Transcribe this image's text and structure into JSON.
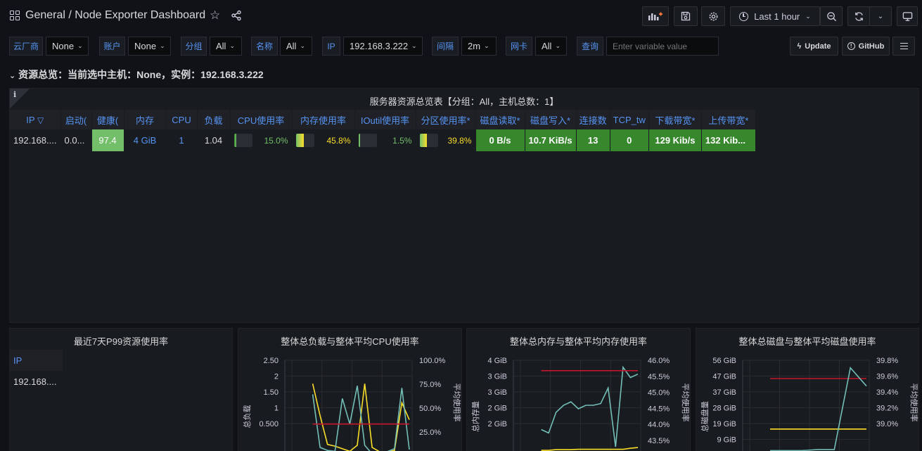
{
  "header": {
    "breadcrumb": "General / Node Exporter Dashboard",
    "time_range": "Last 1 hour",
    "icons": [
      "apps-icon",
      "star-icon",
      "share-icon",
      "add-panel-icon",
      "save-icon",
      "gear-icon",
      "clock-icon",
      "chevron-down-icon",
      "zoom-out-icon",
      "refresh-icon",
      "chevron-down-icon",
      "tv-monitor-icon"
    ]
  },
  "variables": [
    {
      "label": "云厂商",
      "value": "None"
    },
    {
      "label": "账户",
      "value": "None"
    },
    {
      "label": "分组",
      "value": "All"
    },
    {
      "label": "名称",
      "value": "All"
    },
    {
      "label": "IP",
      "value": "192.168.3.222"
    },
    {
      "label": "间隔",
      "value": "2m"
    },
    {
      "label": "网卡",
      "value": "All"
    },
    {
      "label": "查询",
      "placeholder": "Enter variable value"
    }
  ],
  "links": {
    "update": "Update",
    "github": "GitHub"
  },
  "row": {
    "title": "资源总览：当前选中主机：None，实例：192.168.3.222"
  },
  "overview_panel": {
    "info_glyph": "i",
    "title": "服务器资源总览表【分组：All，主机总数：1】",
    "columns": [
      "IP",
      "启动(",
      "健康(",
      "内存",
      "CPU",
      "负载",
      "CPU使用率",
      "内存使用率",
      "IOutil使用率",
      "分区使用率*",
      "磁盘读取*",
      "磁盘写入*",
      "连接数",
      "TCP_tw",
      "下载带宽*",
      "上传带宽*"
    ],
    "row": {
      "ip": "192.168....",
      "uptime": "0.0...",
      "health": "97.4",
      "memory": "4 GiB",
      "cpu": "1",
      "load": "1.04",
      "cpu_usage": "15.0%",
      "cpu_usage_level": 0.15,
      "mem_usage": "45.8%",
      "mem_usage_level": 0.458,
      "ioutil": "1.5%",
      "ioutil_level": 0.015,
      "partition": "39.8%",
      "partition_level": 0.398,
      "disk_read": "0 B/s",
      "disk_write": "10.7 KiB/s",
      "connections": "13",
      "tcp_tw": "0",
      "download": "129 Kib/s",
      "upload": "132 Kib..."
    }
  },
  "p99_panel": {
    "title": "最近7天P99资源使用率",
    "column": "IP",
    "value": "192.168...."
  },
  "charts": {
    "chart_data": [
      {
        "type": "line",
        "title": "整体总负载与整体平均CPU使用率",
        "ylabel": "总负载",
        "ylabel_right": "平均使用率",
        "y_ticks": [
          "2.50",
          "2",
          "1.50",
          "1",
          "0.500"
        ],
        "y_ticks_right": [
          "100.0%",
          "75.0%",
          "50.0%",
          "25.0%"
        ],
        "ylim": [
          0.3,
          2.5
        ],
        "series": [
          {
            "color": "#fade2a",
            "values": [
              1.95,
              1.2,
              0.52,
              0.48,
              0.42,
              0.36,
              0.5,
              1.95,
              0.45,
              0.35,
              0.34,
              0.38,
              1.5,
              1.1
            ]
          },
          {
            "color": "#73bfb8",
            "values": [
              1.7,
              0.45,
              0.38,
              0.36,
              1.6,
              1.0,
              1.9,
              0.5,
              0.3,
              0.32,
              0.35,
              0.42,
              1.85,
              0.4
            ]
          },
          {
            "color": "#c4162a",
            "values": [
              1.0,
              1.0,
              1.0,
              1.0,
              1.0,
              1.0,
              1.0,
              1.0,
              1.0,
              1.0,
              1.0,
              1.0,
              1.0,
              1.0
            ]
          }
        ]
      },
      {
        "type": "line",
        "title": "整体总内存与整体平均内存使用率",
        "ylabel": "总内存量",
        "ylabel_right": "平均使用率",
        "y_ticks": [
          "4 GiB",
          "3 GiB",
          "3 GiB",
          "2 GiB",
          "2 GiB"
        ],
        "y_ticks_right": [
          "46.0%",
          "45.5%",
          "45.0%",
          "44.5%",
          "44.0%",
          "43.5%"
        ],
        "ylim": [
          43.4,
          46.1
        ],
        "series": [
          {
            "color": "#73bfb8",
            "values": [
              44.1,
              44.0,
              44.6,
              44.8,
              44.9,
              44.7,
              44.8,
              44.8,
              44.85,
              45.3,
              43.6,
              45.9,
              45.6,
              45.7
            ]
          },
          {
            "color": "#c4162a",
            "values": [
              45.8,
              45.8,
              45.8,
              45.8,
              45.8,
              45.8,
              45.8,
              45.8,
              45.8,
              45.8,
              45.8,
              45.8,
              45.8,
              45.8
            ]
          },
          {
            "color": "#fade2a",
            "values": [
              43.5,
              43.5,
              43.52,
              43.52,
              43.52,
              43.53,
              43.53,
              43.53,
              43.53,
              43.53,
              43.53,
              43.53,
              43.56,
              43.58
            ]
          }
        ]
      },
      {
        "type": "line",
        "title": "整体总磁盘与整体平均磁盘使用率",
        "ylabel": "总磁盘量",
        "ylabel_right": "平均使用率",
        "y_ticks": [
          "56 GiB",
          "47 GiB",
          "37 GiB",
          "28 GiB",
          "19 GiB",
          "9 GiB"
        ],
        "y_ticks_right": [
          "39.8%",
          "39.6%",
          "39.4%",
          "39.2%",
          "39.0%"
        ],
        "ylim": [
          38.95,
          39.82
        ],
        "series": [
          {
            "color": "#c4162a",
            "values": [
              39.65,
              39.65,
              39.65,
              39.65,
              39.65,
              39.65,
              39.65
            ]
          },
          {
            "color": "#fade2a",
            "values": [
              39.18,
              39.18,
              39.18,
              39.18,
              39.18,
              39.18,
              39.18
            ]
          },
          {
            "color": "#73bfb8",
            "values": [
              38.98,
              38.98,
              38.98,
              38.99,
              38.99,
              39.75,
              39.58
            ]
          }
        ]
      }
    ]
  }
}
